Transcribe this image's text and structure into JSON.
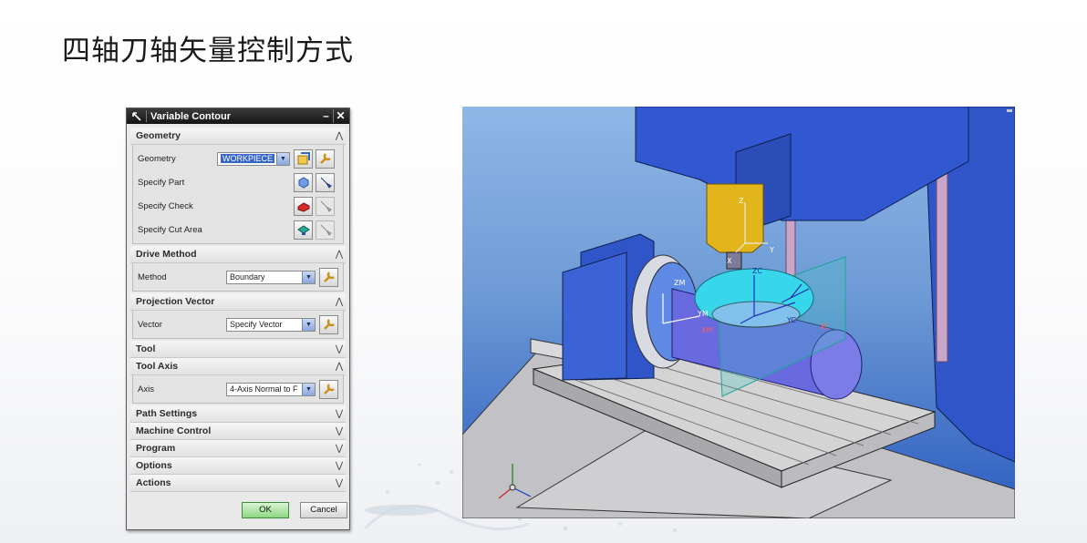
{
  "slide": {
    "title": "四轴刀轴矢量控制方式"
  },
  "dialog": {
    "title": "Variable Contour",
    "sections": {
      "geometry": {
        "header": "Geometry",
        "geometry_label": "Geometry",
        "geometry_value": "WORKPIECE",
        "specify_part": "Specify Part",
        "specify_check": "Specify Check",
        "specify_cut_area": "Specify Cut Area"
      },
      "drive_method": {
        "header": "Drive Method",
        "method_label": "Method",
        "method_value": "Boundary"
      },
      "projection_vector": {
        "header": "Projection Vector",
        "vector_label": "Vector",
        "vector_value": "Specify Vector"
      },
      "tool": {
        "header": "Tool"
      },
      "tool_axis": {
        "header": "Tool Axis",
        "axis_label": "Axis",
        "axis_value": "4-Axis Normal to F"
      },
      "path_settings": {
        "header": "Path Settings"
      },
      "machine_control": {
        "header": "Machine Control"
      },
      "program": {
        "header": "Program"
      },
      "options": {
        "header": "Options"
      },
      "actions": {
        "header": "Actions"
      }
    },
    "buttons": {
      "ok": "OK",
      "cancel": "Cancel"
    }
  },
  "viewport": {
    "axis_labels": {
      "x": "X",
      "y": "Y",
      "z": "Z",
      "xm": "XM",
      "ym": "YM",
      "zm": "ZM",
      "xc": "XC",
      "yc": "YC",
      "zc": "ZC"
    },
    "colors": {
      "machine": "#2f55c8",
      "spindle": "#e2b51a",
      "workpiece": "#6a6ae0",
      "disc": "#38d6ea",
      "table": "#d4d4d4"
    }
  }
}
